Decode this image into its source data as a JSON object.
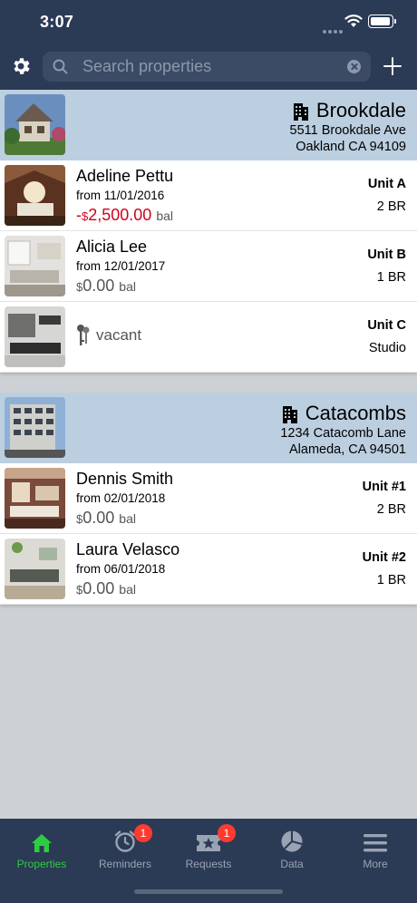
{
  "status_bar": {
    "time": "3:07"
  },
  "search": {
    "placeholder": "Search properties"
  },
  "properties": [
    {
      "name": "Brookdale",
      "address_line1": "5511 Brookdale Ave",
      "address_line2": "Oakland CA 94109",
      "units": [
        {
          "tenant": "Adeline Pettu",
          "from": "from 11/01/2016",
          "sign": "-",
          "currency": "$",
          "balance": "2,500.00",
          "bal_label": "bal",
          "unit": "Unit A",
          "bedrooms": "2 BR"
        },
        {
          "tenant": "Alicia Lee",
          "from": "from 12/01/2017",
          "sign": "",
          "currency": "$",
          "balance": "0.00",
          "bal_label": "bal",
          "unit": "Unit B",
          "bedrooms": "1 BR"
        },
        {
          "status": "vacant",
          "unit": "Unit C",
          "bedrooms": "Studio"
        }
      ]
    },
    {
      "name": "Catacombs",
      "address_line1": "1234 Catacomb Lane",
      "address_line2": "Alameda, CA 94501",
      "units": [
        {
          "tenant": "Dennis Smith",
          "from": "from 02/01/2018",
          "sign": "",
          "currency": "$",
          "balance": "0.00",
          "bal_label": "bal",
          "unit": "Unit #1",
          "bedrooms": "2 BR"
        },
        {
          "tenant": "Laura Velasco",
          "from": "from 06/01/2018",
          "sign": "",
          "currency": "$",
          "balance": "0.00",
          "bal_label": "bal",
          "unit": "Unit #2",
          "bedrooms": "1 BR"
        }
      ]
    }
  ],
  "tabs": [
    {
      "label": "Properties",
      "icon": "home-icon",
      "active": true
    },
    {
      "label": "Reminders",
      "icon": "alarm-clock-icon",
      "badge": "1"
    },
    {
      "label": "Requests",
      "icon": "ticket-star-icon",
      "badge": "1"
    },
    {
      "label": "Data",
      "icon": "pie-chart-icon"
    },
    {
      "label": "More",
      "icon": "menu-icon"
    }
  ],
  "colors": {
    "accent_active": "#2ecc40",
    "nav_bg": "#2b3a55",
    "header_bg": "#bccfe0",
    "negative": "#d0021b",
    "badge": "#ff3b30"
  }
}
